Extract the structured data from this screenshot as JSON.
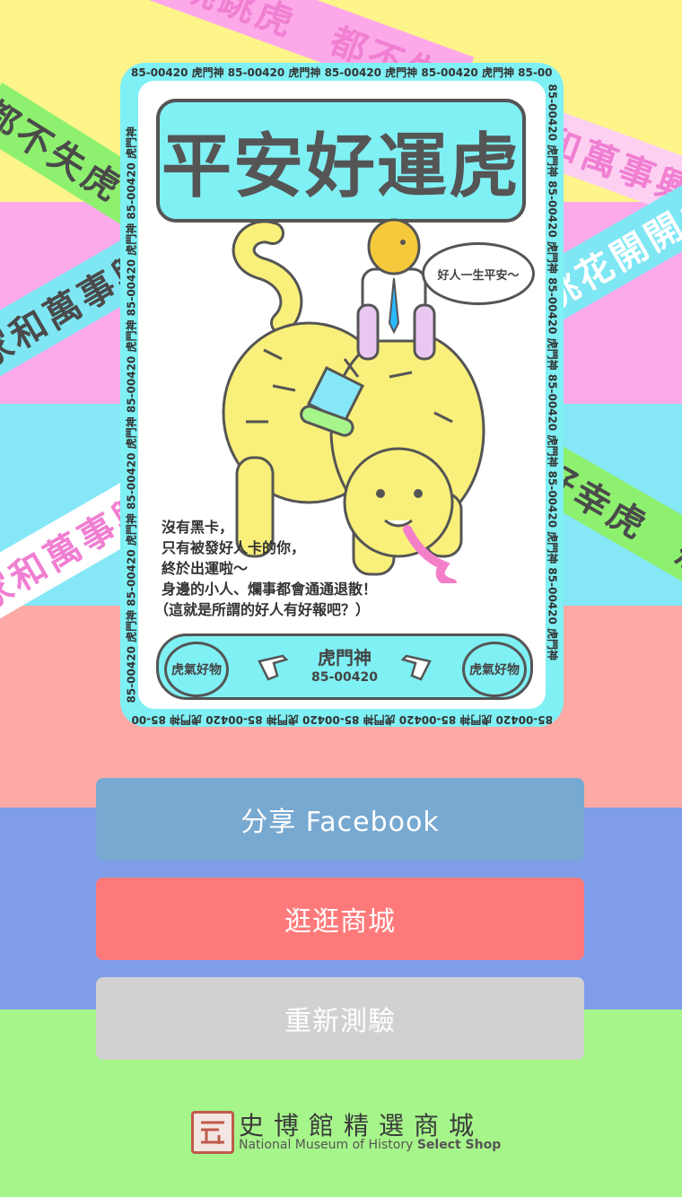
{
  "background": {
    "stripe_colors": [
      "#fdf58a",
      "#fdaaea",
      "#86e7f7",
      "#fda9a6",
      "#7f9de9",
      "#a6f58a"
    ]
  },
  "ribbons": [
    {
      "text": "健康跳跳虎　都不失虎　健康跳跳虎",
      "color": "#f07fd2",
      "bg": "#fda9e9"
    },
    {
      "text": "家和萬事興　財運亨通　家和萬事興",
      "color": "#f07fd2",
      "bg": "#fdd0f1"
    },
    {
      "text": "都不失虎　家和萬事興",
      "color": "#4a4a4a",
      "bg": "#8ef06f"
    },
    {
      "text": "家和萬事興　平安好運",
      "color": "#4a4a4a",
      "bg": "#7fe6f4"
    },
    {
      "text": "桃花開開虎　家和萬事",
      "color": "#ffffff",
      "bg": "#7fe6f4"
    },
    {
      "text": "好幸虎　想要",
      "color": "#4a4a4a",
      "bg": "#8ef06f"
    },
    {
      "text": "家和萬事興　小",
      "color": "#f07fd2",
      "bg": "#ffffff"
    }
  ],
  "card": {
    "border_text": "85-00420 虎門神 85-00420 虎門神 85-00420 虎門神 85-00420 虎門神 85-00420 虎門神 85-00420 虎門神",
    "title": "平安好運虎",
    "bubble": "好人一生平安～",
    "message_lines": [
      "沒有黑卡，",
      "只有被發好人卡的你，",
      "終於出運啦～",
      "身邊的小人、爛事都會通通退散！",
      "（這就是所謂的好人有好報吧？）"
    ],
    "footer": {
      "brand": "虎門神",
      "code": "85-00420",
      "stamp_text": "虎氣好物"
    }
  },
  "buttons": {
    "share": {
      "label": "分享 Facebook",
      "color": "#78a9d1"
    },
    "shop": {
      "label": "逛逛商城",
      "color": "#fe7a7a"
    },
    "retry": {
      "label": "重新測驗",
      "color": "#d1d1d1"
    }
  },
  "logo": {
    "name_cn": "史博館精選商城",
    "name_en": "National Museum of History",
    "name_en_bold": "Select Shop"
  }
}
